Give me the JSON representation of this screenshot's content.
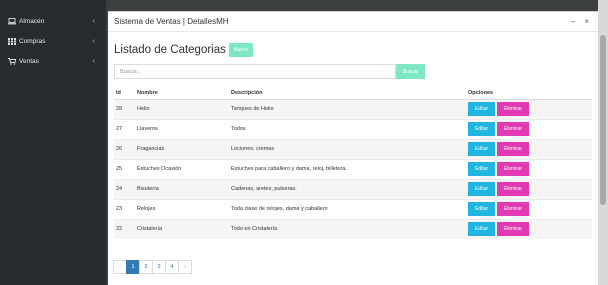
{
  "sidebar": {
    "items": [
      {
        "icon": "laptop-icon",
        "label": "Almacén"
      },
      {
        "icon": "grid-icon",
        "label": "Compras"
      },
      {
        "icon": "cart-icon",
        "label": "Ventas"
      }
    ]
  },
  "modal": {
    "title": "Sistema de Ventas | DetallesMH",
    "minimize": "–",
    "close": "×"
  },
  "main": {
    "heading": "Listado de Categorias",
    "new_button": "Nuevo",
    "search_placeholder": "Buscar...",
    "search_button": "Buscar"
  },
  "table": {
    "headers": [
      "Id",
      "Nombre",
      "Descripción",
      "Opciones"
    ],
    "edit_label": "Editar",
    "delete_label": "Eliminar",
    "rows": [
      {
        "id": "28",
        "name": "Helio",
        "desc": "Tanques de Helio"
      },
      {
        "id": "27",
        "name": "Llaveros",
        "desc": "Todos"
      },
      {
        "id": "26",
        "name": "Fragancias",
        "desc": "Lociones, cremas"
      },
      {
        "id": "25",
        "name": "Estuches Ocasión",
        "desc": "Estuches para caballero y dama, reloj, billetera."
      },
      {
        "id": "24",
        "name": "Bisutería",
        "desc": "Cadenas, aretes, pulseras."
      },
      {
        "id": "23",
        "name": "Relojes",
        "desc": "Toda clase de relojes, dama y caballero"
      },
      {
        "id": "22",
        "name": "Cristalería",
        "desc": "Todo en Cristalería"
      }
    ]
  },
  "pagination": {
    "prev": "‹",
    "pages": [
      "1",
      "2",
      "3",
      "4"
    ],
    "next": "›",
    "active": "1"
  }
}
